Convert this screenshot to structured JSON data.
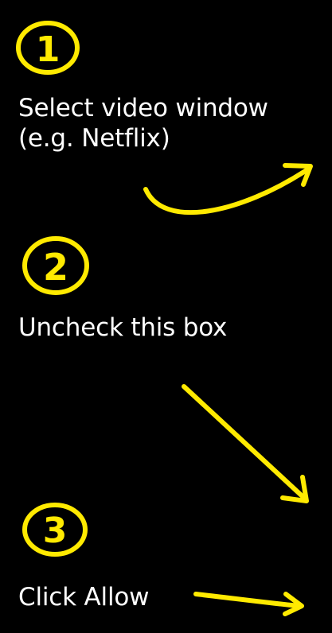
{
  "colors": {
    "background": "#000000",
    "text": "#ffffff",
    "accent": "#ffea00"
  },
  "steps": [
    {
      "number": "1",
      "icon": "circled-number-one-icon",
      "line1": "Select video window",
      "line2": "(e.g. Netflix)",
      "arrow_icon": "curved-arrow-up-right-icon"
    },
    {
      "number": "2",
      "icon": "circled-number-two-icon",
      "line1": "Uncheck this box",
      "arrow_icon": "arrow-down-right-icon"
    },
    {
      "number": "3",
      "icon": "circled-number-three-icon",
      "line1": "Click Allow",
      "arrow_icon": "arrow-right-icon"
    }
  ]
}
